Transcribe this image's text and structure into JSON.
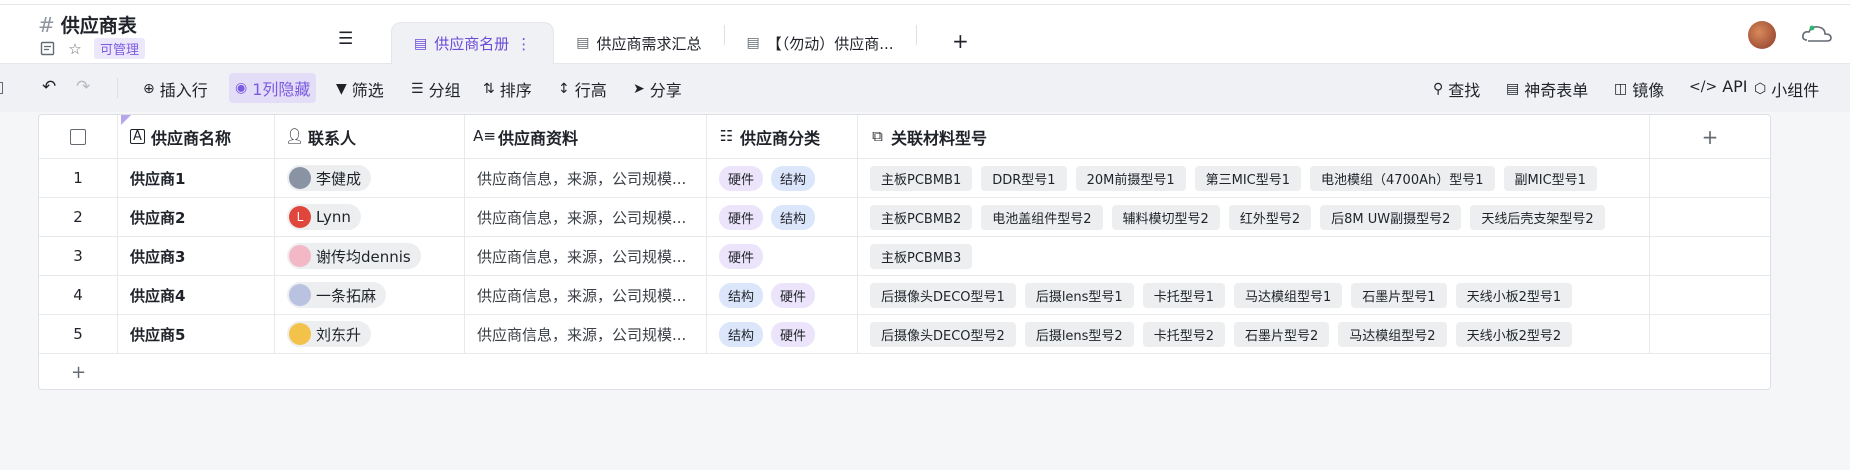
{
  "header": {
    "title": "供应商表",
    "permission": "可管理",
    "tabs": [
      {
        "label": "供应商名册",
        "active": true
      },
      {
        "label": "供应商需求汇总",
        "active": false
      },
      {
        "label": "【（勿动）供应商...",
        "active": false
      }
    ]
  },
  "toolbar": {
    "insert_row": "插入行",
    "hidden_cols": "1列隐藏",
    "filter": "筛选",
    "group": "分组",
    "sort": "排序",
    "row_height": "行高",
    "share": "分享",
    "search": "查找",
    "magic_form": "神奇表单",
    "mirror": "镜像",
    "api": "API",
    "widget": "小组件"
  },
  "columns": {
    "name": "供应商名称",
    "contact": "联系人",
    "info": "供应商资料",
    "category": "供应商分类",
    "materials": "关联材料型号"
  },
  "rows": [
    {
      "index": "1",
      "name": "供应商1",
      "contact": "李健成",
      "avatar_letter": "",
      "info": "供应商信息，来源，公司规模...",
      "categories": [
        "硬件",
        "结构"
      ],
      "materials": [
        "主板PCBMB1",
        "DDR型号1",
        "20M前摄型号1",
        "第三MIC型号1",
        "电池模组（4700Ah）型号1",
        "副MIC型号1"
      ]
    },
    {
      "index": "2",
      "name": "供应商2",
      "contact": "Lynn",
      "avatar_letter": "L",
      "info": "供应商信息，来源，公司规模...",
      "categories": [
        "硬件",
        "结构"
      ],
      "materials": [
        "主板PCBMB2",
        "电池盖组件型号2",
        "辅料模切型号2",
        "红外型号2",
        "后8M UW副摄型号2",
        "天线后壳支架型号2"
      ]
    },
    {
      "index": "3",
      "name": "供应商3",
      "contact": "谢传均dennis",
      "avatar_letter": "",
      "info": "供应商信息，来源，公司规模...",
      "categories": [
        "硬件"
      ],
      "materials": [
        "主板PCBMB3"
      ]
    },
    {
      "index": "4",
      "name": "供应商4",
      "contact": "一条拓麻",
      "avatar_letter": "",
      "info": "供应商信息，来源，公司规模...",
      "categories": [
        "结构",
        "硬件"
      ],
      "materials": [
        "后摄像头DECO型号1",
        "后摄lens型号1",
        "卡托型号1",
        "马达模组型号1",
        "石墨片型号1",
        "天线小板2型号1"
      ]
    },
    {
      "index": "5",
      "name": "供应商5",
      "contact": "刘东升",
      "avatar_letter": "",
      "info": "供应商信息，来源，公司规模...",
      "categories": [
        "结构",
        "硬件"
      ],
      "materials": [
        "后摄像头DECO型号2",
        "后摄lens型号2",
        "卡托型号2",
        "石墨片型号2",
        "马达模组型号2",
        "天线小板2型号2"
      ]
    }
  ],
  "colors": {
    "accent": "#6c4bd8",
    "tag_hardware": "#ece4fb",
    "tag_structure": "#dbe6fa"
  }
}
